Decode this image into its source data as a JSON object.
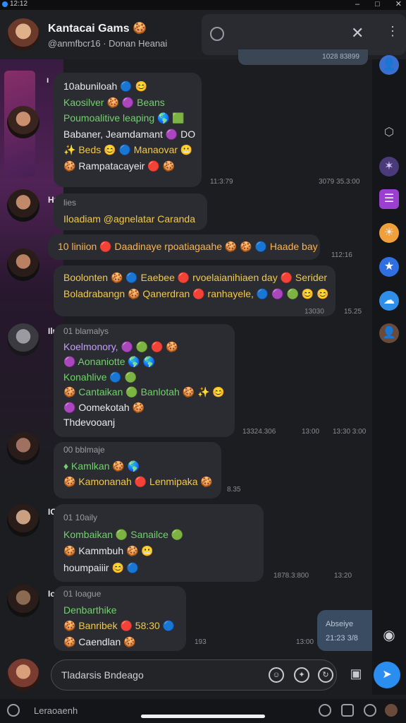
{
  "status_bar": {
    "time": "12:12"
  },
  "header": {
    "title": "Kantacai Gams 🍪",
    "subtitle": "@anmfbcr16 · Donan Heanai",
    "top_pill": "1028 83899"
  },
  "messages": [
    {
      "lines": [
        {
          "text": "10abuniloah 🔵 😊",
          "color": "white"
        },
        {
          "text": "Kaosilver 🍪 🟣 Beans",
          "color": "green"
        },
        {
          "text": "Poumoalitive leaping 🌎 🟩",
          "color": "green"
        },
        {
          "text": "Babaner, Jeamdamant 🟣 DO",
          "color": "white"
        },
        {
          "text": "✨ Beds 😊 🔵 Manaovar 😬",
          "color": "yellow"
        },
        {
          "text": "🍪 Rampatacayeir 🔴 🍪",
          "color": "white"
        }
      ],
      "time_left": "11:3:79",
      "time_right": "3079 35.3:00"
    },
    {
      "sender": "Hutan",
      "lines": [
        {
          "text": "lies",
          "color": "gray"
        },
        {
          "text": "Iloadiam @agnelatar Caranda",
          "color": "yellow"
        }
      ]
    },
    {
      "lines": [
        {
          "text": "10 liniion 🔴 Daadinaye rpoatiagaahe 🍪 🍪 🔵 Haade bay",
          "color": "orange"
        }
      ],
      "time_right": "112:16"
    },
    {
      "lines": [
        {
          "text": "Boolonten 🍪 🔵 Eaebee 🔴 rvoelaianihiaen day 🔴 Serider",
          "color": "yellow"
        },
        {
          "text": "Boladrabangn 🍪 Qanerdran 🔴 ranhayele, 🔵 🟣 🟢 😊 😊",
          "color": "yellow"
        }
      ],
      "time_inner": "13030",
      "time_right": "15.25"
    },
    {
      "sender": "Ilutes",
      "lines": [
        {
          "text": "01 blamalys",
          "color": "gray"
        },
        {
          "text": "Koelmonory, 🟣 🟢 🔴 🍪",
          "color": "purple"
        },
        {
          "text": "🟣 Aonaniotte 🌎 🌎",
          "color": "green"
        },
        {
          "text": "Konahlive 🔵 🟢",
          "color": "green"
        },
        {
          "text": "🍪 Cantaikan 🟢 Banlotah 🍪 ✨ 😊",
          "color": "green"
        },
        {
          "text": "🟣 Oomekotah 🍪",
          "color": "white"
        },
        {
          "text": "Thdevooanj",
          "color": "white"
        }
      ],
      "time_mid": "13324.306",
      "time_mid2": "13:00",
      "time_right": "13:30 3:00"
    },
    {
      "lines": [
        {
          "text": "00 bblmaje",
          "color": "gray"
        },
        {
          "text": "♦ Kamlkan 🍪 🌎",
          "color": "green"
        },
        {
          "text": "🍪 Kamonanah 🔴 Lenmipaka 🍪",
          "color": "yellow"
        }
      ],
      "time_right": "8.35"
    },
    {
      "sender": "IGI",
      "lines": [
        {
          "text": "01 10aily",
          "color": "gray"
        },
        {
          "text": "Kombaikan 🟢 Sanailce 🟢",
          "color": "green"
        },
        {
          "text": "🍪 Kammbuh 🍪 😬",
          "color": "white"
        },
        {
          "text": "houmpaiiir 😊 🔵",
          "color": "white"
        }
      ],
      "time_mid": "1878.3:800",
      "time_right": "13:20"
    },
    {
      "sender": "Ioam",
      "lines": [
        {
          "text": "01 Ioague",
          "color": "gray"
        },
        {
          "text": "Denbarthike",
          "color": "green"
        },
        {
          "text": "🍪 Banribek 🔴 58:30 🔵",
          "color": "yellow"
        },
        {
          "text": "🍪 Caendlan 🍪",
          "color": "white"
        }
      ],
      "time_mid": "193",
      "time_right": "13:00"
    }
  ],
  "outgoing": {
    "label": "Abseiye",
    "time": "21:23 3/8"
  },
  "composer": {
    "placeholder": "Tladarsis Bndeago"
  },
  "bottom_bar": {
    "label": "Leraoaenh"
  },
  "colors": {
    "accent": "#2a8df0",
    "bubble": "#2b2c31",
    "background": "#1c1d21"
  }
}
